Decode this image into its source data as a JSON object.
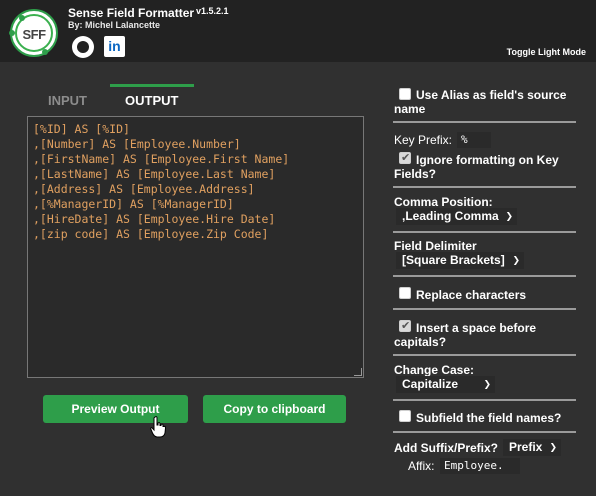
{
  "header": {
    "logo_text": "SFF",
    "title": "Sense Field Formatter",
    "version": "v1.5.2.1",
    "author": "By: Michel Lalancette",
    "linkedin_glyph": "in",
    "toggle_mode_label": "Toggle Light Mode"
  },
  "tabs": [
    {
      "label": "INPUT",
      "active": false
    },
    {
      "label": "OUTPUT",
      "active": true
    }
  ],
  "output": {
    "lines": [
      "[%ID] AS [%ID]",
      ",[Number] AS [Employee.Number]",
      ",[FirstName] AS [Employee.First Name]",
      ",[LastName] AS [Employee.Last Name]",
      ",[Address] AS [Employee.Address]",
      ",[%ManagerID] AS [%ManagerID]",
      ",[HireDate] AS [Employee.Hire Date]",
      ",[zip code] AS [Employee.Zip Code]"
    ]
  },
  "buttons": {
    "preview": "Preview Output",
    "copy": "Copy to clipboard"
  },
  "options": {
    "use_alias": {
      "label": "Use Alias as field's source name",
      "checked": false
    },
    "key_prefix": {
      "label": "Key Prefix:",
      "value": "%"
    },
    "ignore_formatting": {
      "label": "Ignore formatting on Key Fields?",
      "checked": true
    },
    "comma_position": {
      "label": "Comma Position:",
      "value": ",Leading Comma"
    },
    "field_delimiter": {
      "label": "Field Delimiter",
      "value": "[Square Brackets]"
    },
    "replace_characters": {
      "label": "Replace characters",
      "checked": false
    },
    "insert_space": {
      "label": "Insert a space before capitals?",
      "checked": true
    },
    "change_case": {
      "label": "Change Case:",
      "value": "Capitalize"
    },
    "subfield": {
      "label": "Subfield the field names?",
      "checked": false
    },
    "suffix_prefix": {
      "label": "Add Suffix/Prefix?",
      "value": "Prefix"
    },
    "affix": {
      "label": "Affix:",
      "value": "Employee."
    }
  },
  "colors": {
    "accent": "#2e9e4a",
    "code_text": "#e0a060",
    "background": "#303030",
    "header": "#222222"
  }
}
